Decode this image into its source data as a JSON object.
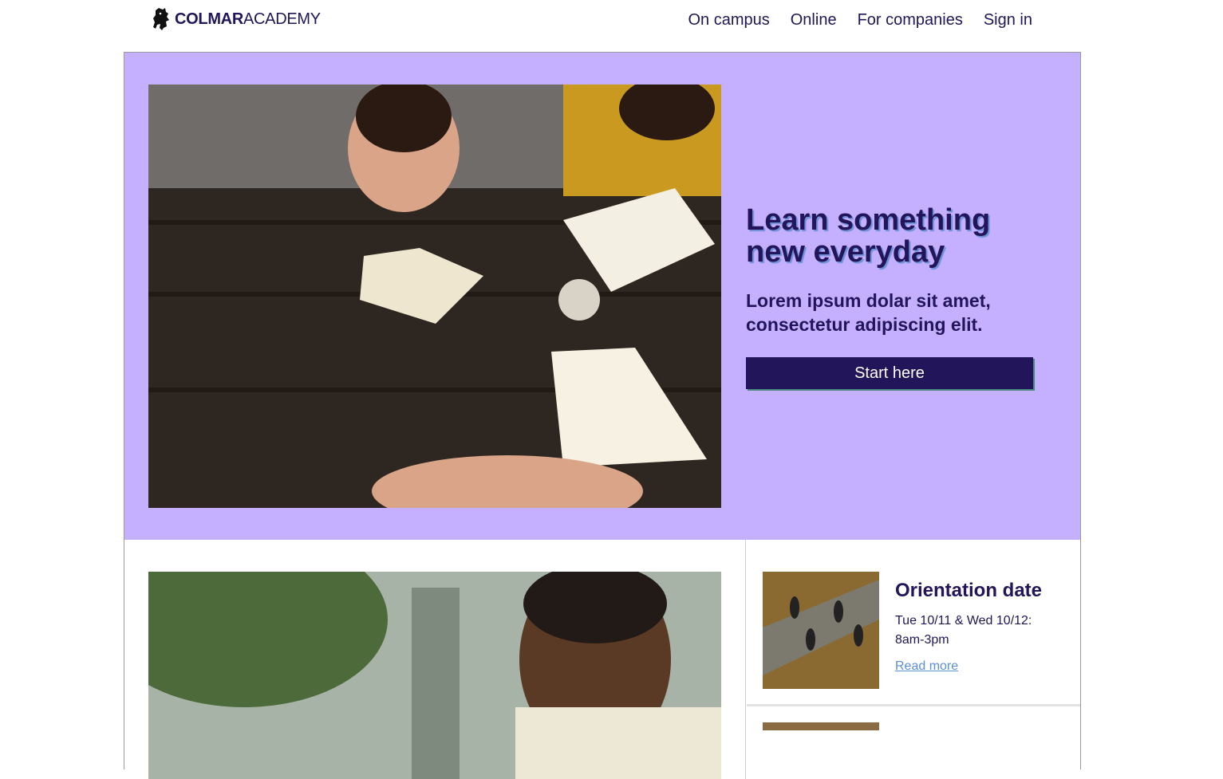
{
  "header": {
    "logo_bold": "COLMAR",
    "logo_regular": "ACADEMY",
    "nav": [
      "On campus",
      "Online",
      "For companies",
      "Sign in"
    ]
  },
  "hero": {
    "title": "Learn something new everyday",
    "subtitle": "Lorem ipsum dolar sit amet, consectetur adipiscing elit.",
    "cta_label": "Start here"
  },
  "event": {
    "title": "Orientation date",
    "description": "Tue 10/11 & Wed 10/12: 8am-3pm",
    "link": "Read more"
  },
  "colors": {
    "brand": "#221559",
    "hero_bg": "#c4b0ff",
    "link": "#5b8fd6"
  },
  "icons": [
    "lion-logo-icon"
  ]
}
